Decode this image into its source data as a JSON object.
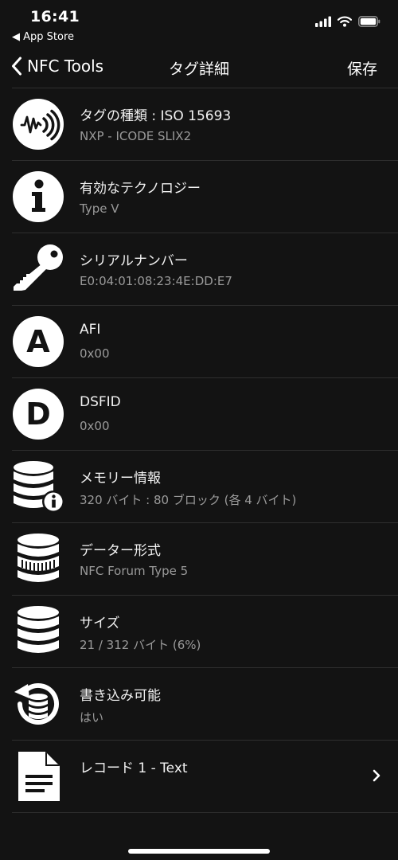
{
  "status_bar": {
    "time": "16:41",
    "back_app": "◀ App Store"
  },
  "nav": {
    "back_label": "NFC Tools",
    "title": "タグ詳細",
    "save_label": "保存"
  },
  "rows": [
    {
      "title": "タグの種類 : ISO 15693",
      "value": "NXP - ICODE SLIX2",
      "icon": "nfc-wave-icon"
    },
    {
      "title": "有効なテクノロジー",
      "value": "Type V",
      "icon": "info-icon"
    },
    {
      "title": "シリアルナンバー",
      "value": "E0:04:01:08:23:4E:DD:E7",
      "icon": "key-icon"
    },
    {
      "title": "AFI",
      "value": "0x00",
      "icon": "letter-a-icon"
    },
    {
      "title": "DSFID",
      "value": "0x00",
      "icon": "letter-d-icon"
    },
    {
      "title": "メモリー情報",
      "value": "320 バイト : 80 ブロック (各 4 バイト)",
      "icon": "database-info-icon"
    },
    {
      "title": "データー形式",
      "value": "NFC Forum Type 5",
      "icon": "database-format-icon"
    },
    {
      "title": "サイズ",
      "value": "21 / 312 バイト (6%)",
      "icon": "database-icon"
    },
    {
      "title": "書き込み可能",
      "value": "はい",
      "icon": "database-refresh-icon"
    },
    {
      "title": "レコード 1 - Text",
      "value": "",
      "icon": "document-icon"
    }
  ]
}
